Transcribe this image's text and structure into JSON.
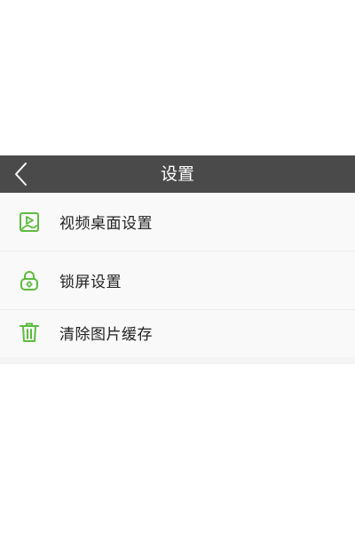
{
  "header": {
    "title": "设置",
    "back_icon": "chevron-left-icon"
  },
  "settings": {
    "items": [
      {
        "label": "视频桌面设置",
        "icon": "video-wallpaper-icon"
      },
      {
        "label": "锁屏设置",
        "icon": "lock-settings-icon"
      },
      {
        "label": "清除图片缓存",
        "icon": "trash-icon"
      }
    ]
  },
  "colors": {
    "header_bg": "#4a4a4a",
    "accent": "#5dbb3f",
    "list_bg": "#f9f9f9",
    "text": "#222222"
  }
}
